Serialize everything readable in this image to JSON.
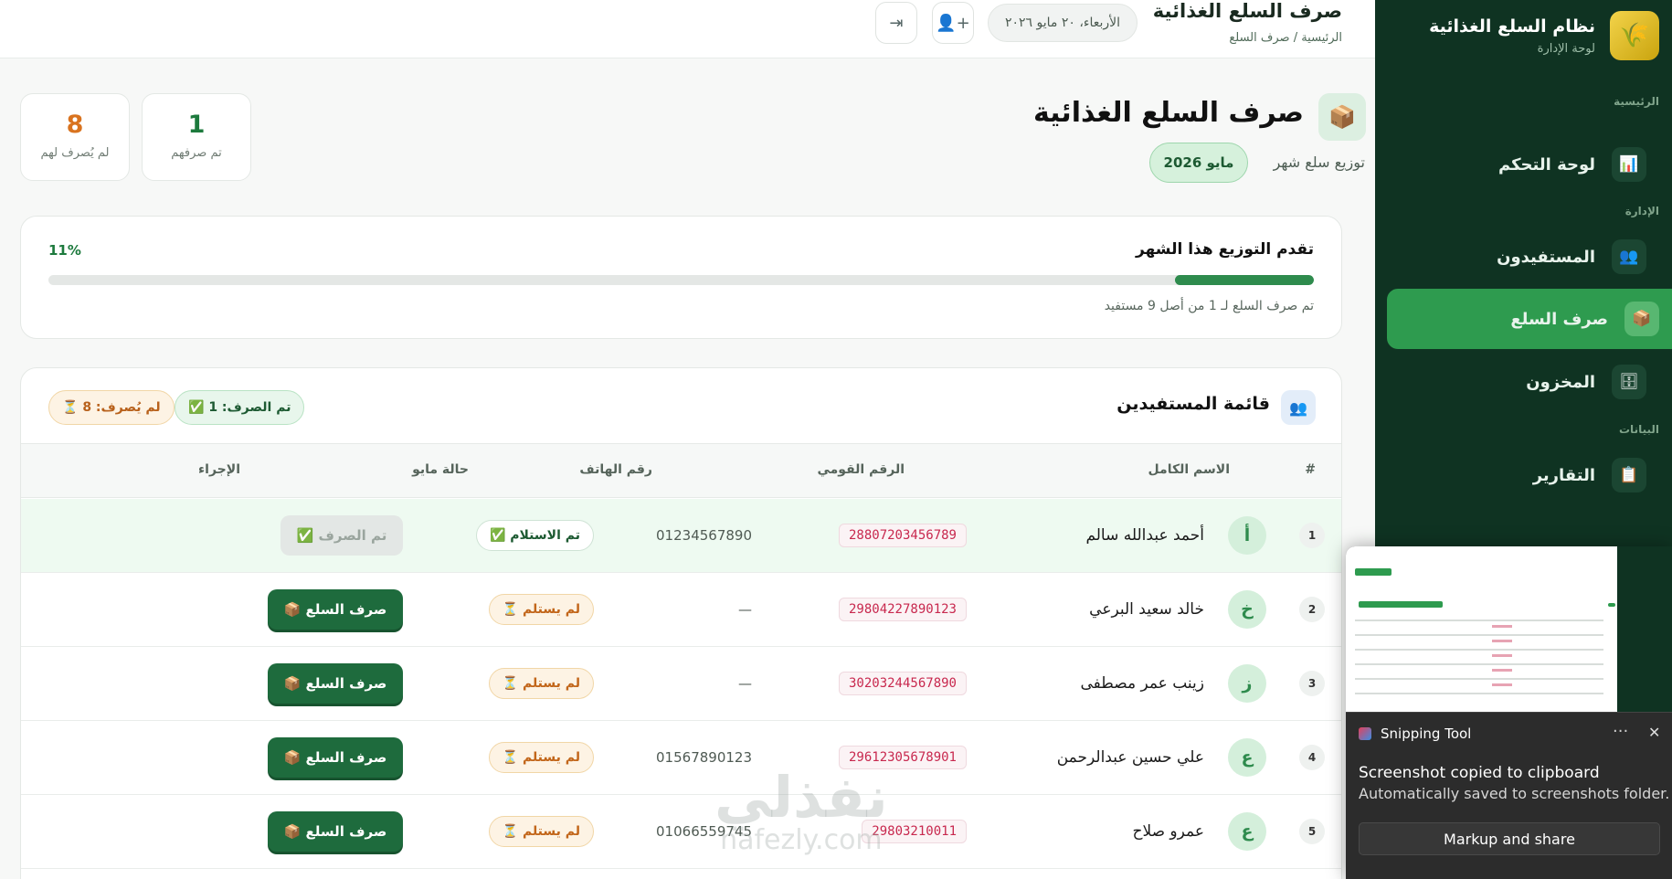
{
  "sidebar": {
    "brand_title": "نظام السلع الغذائية",
    "brand_sub": "لوحة الإدارة",
    "sections": {
      "main": "الرئيسية",
      "admin": "الإدارة",
      "data": "البيانات"
    },
    "items": [
      {
        "label": "لوحة التحكم",
        "icon": "📊"
      },
      {
        "label": "المستفيدون",
        "icon": "👥"
      },
      {
        "label": "صرف السلع",
        "icon": "📦"
      },
      {
        "label": "المخزون",
        "icon": "🗄"
      },
      {
        "label": "التقارير",
        "icon": "📋"
      }
    ]
  },
  "header": {
    "title": "صرف السلع الغذائية",
    "breadcrumb": "الرئيسية / صرف السلع",
    "date": "الأربعاء، ٢٠ مايو ٢٠٢٦",
    "add_user_icon": "👤+",
    "logout_icon": "⇥"
  },
  "page": {
    "icon": "📦",
    "title": "صرف السلع الغذائية",
    "subtitle": "توزيع سلع شهر",
    "month": "مايو 2026",
    "stats": {
      "done": {
        "value": "1",
        "label": "تم صرفهم"
      },
      "pending": {
        "value": "8",
        "label": "لم يُصرف لهم"
      }
    }
  },
  "progress": {
    "title": "تقدم التوزيع هذا الشهر",
    "percent_label": "11%",
    "percent_value": 0.11,
    "note": "تم صرف السلع لـ 1 من أصل 9 مستفيد"
  },
  "list": {
    "icon": "👥",
    "title": "قائمة المستفيدين",
    "badge_done": "✅ تم الصرف: 1",
    "badge_pending": "⏳ لم يُصرف: 8",
    "columns": [
      "#",
      "الاسم الكامل",
      "الرقم القومي",
      "رقم الهاتف",
      "حالة مايو",
      "الإجراء"
    ],
    "rows": [
      {
        "idx": "1",
        "initial": "أ",
        "name": "أحمد عبدالله سالم",
        "nid": "28807203456789",
        "phone": "01234567890",
        "status": "✅ تم الاستلام",
        "received": true,
        "action": "✅ تم الصرف"
      },
      {
        "idx": "2",
        "initial": "خ",
        "name": "خالد سعيد البرعي",
        "nid": "29804227890123",
        "phone": "—",
        "status": "⏳ لم يستلم",
        "received": false,
        "action": "📦 صرف السلع"
      },
      {
        "idx": "3",
        "initial": "ز",
        "name": "زينب عمر مصطفى",
        "nid": "30203244567890",
        "phone": "—",
        "status": "⏳ لم يستلم",
        "received": false,
        "action": "📦 صرف السلع"
      },
      {
        "idx": "4",
        "initial": "ع",
        "name": "علي حسين عبدالرحمن",
        "nid": "29612305678901",
        "phone": "01567890123",
        "status": "⏳ لم يستلم",
        "received": false,
        "action": "📦 صرف السلع"
      },
      {
        "idx": "5",
        "initial": "ع",
        "name": "عمرو صلاح",
        "nid": "29803210011",
        "phone": "01066559745",
        "status": "⏳ لم يستلم",
        "received": false,
        "action": "📦 صرف السلع"
      }
    ]
  },
  "watermark": {
    "arabic": "نفذلي",
    "latin": "nafezly.com"
  },
  "toast": {
    "app": "Snipping Tool",
    "line1": "Screenshot copied to clipboard",
    "line2": "Automatically saved to screenshots folder.",
    "button": "Markup and share",
    "dots": "···",
    "close": "✕"
  }
}
